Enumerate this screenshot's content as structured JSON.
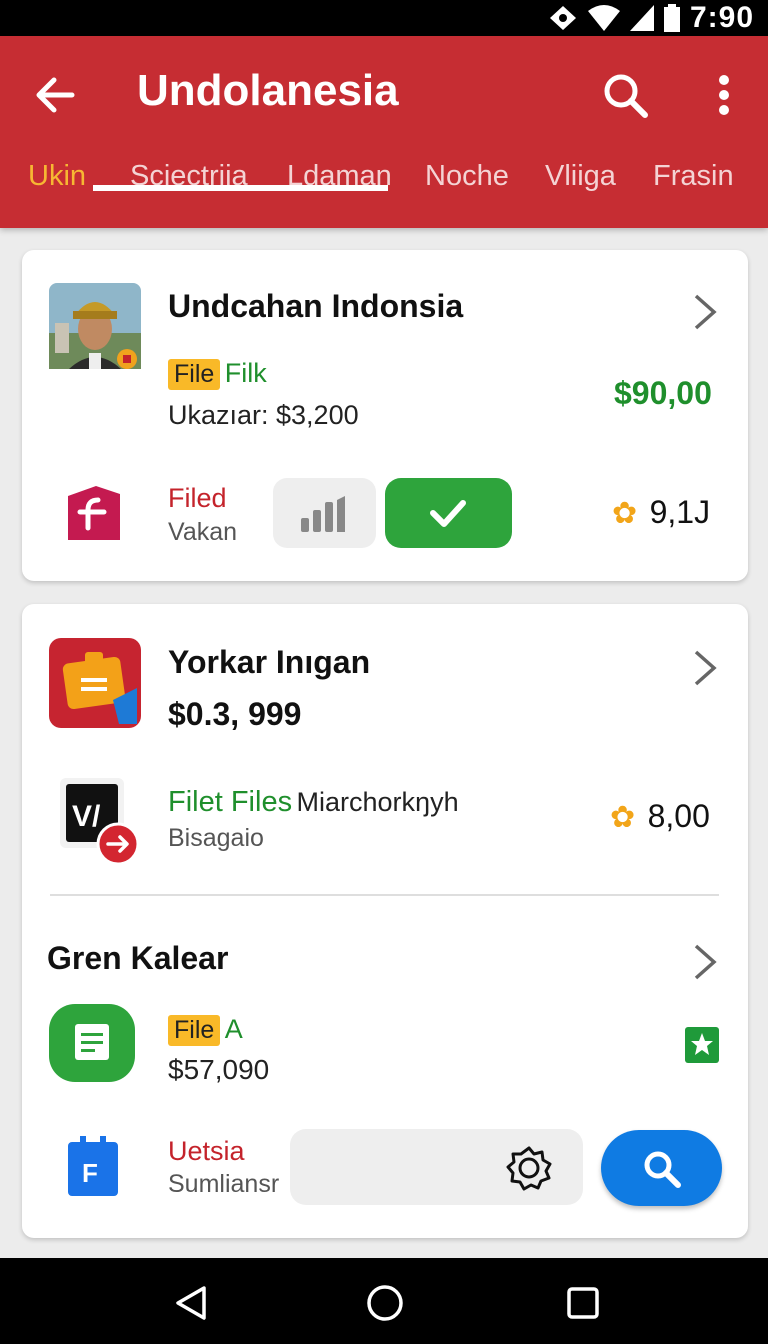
{
  "status_bar": {
    "time": "7:90"
  },
  "app_bar": {
    "title": "Undolanesia",
    "tabs": [
      {
        "label": "Ukin"
      },
      {
        "label": "Scjectriia"
      },
      {
        "label": "Ldaman"
      },
      {
        "label": "Noche"
      },
      {
        "label": "Vliiga"
      },
      {
        "label": "Frasin"
      }
    ]
  },
  "card1": {
    "title": "Undcahan Indonsia",
    "badge": "File",
    "badge_text": "Filk",
    "subtitle": "Ukazıar: $3,200",
    "price": "$90,00",
    "row2": {
      "label": "Filed",
      "sub": "Vakan",
      "rating": "9,1J"
    }
  },
  "card2": {
    "item1": {
      "title": "Yorkar Inıgan",
      "price": "$0.3, 999"
    },
    "item2": {
      "green_label": "Filet  Files",
      "label": "Miarchorkŋyh",
      "sub": "Bisagaio",
      "rating": "8,00"
    },
    "section": {
      "title": "Gren Kalear",
      "badge": "File",
      "badge_text": "A",
      "price": "$57,090"
    },
    "item3": {
      "label": "Uetsia",
      "sub": "Sumliansr"
    }
  },
  "colors": {
    "app_bar": "#c62d33",
    "accent_tab": "#f7b733",
    "green": "#2ea43c",
    "blue_fab": "#0f7be3",
    "badge": "#f9b928"
  }
}
